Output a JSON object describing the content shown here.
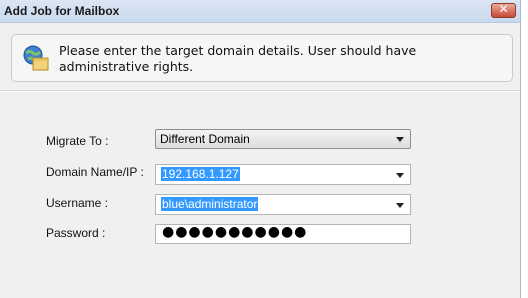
{
  "window": {
    "title": "Add Job for Mailbox",
    "close_glyph": "✕"
  },
  "info": {
    "icon": "globe-folder-icon",
    "message": "Please enter the target domain details. User should have administrative rights."
  },
  "form": {
    "migrate_to": {
      "label": "Migrate To :",
      "value": "Different Domain"
    },
    "domain": {
      "label": "Domain Name/IP :",
      "value": "192.168.1.127"
    },
    "username": {
      "label": "Username :",
      "value": "blue\\administrator"
    },
    "password": {
      "label": "Password :",
      "masked_value": "●●●●●●●●●●●"
    }
  },
  "colors": {
    "selection": "#3399ff",
    "close_button": "#c74a34",
    "titlebar": "#c9d9ee"
  }
}
